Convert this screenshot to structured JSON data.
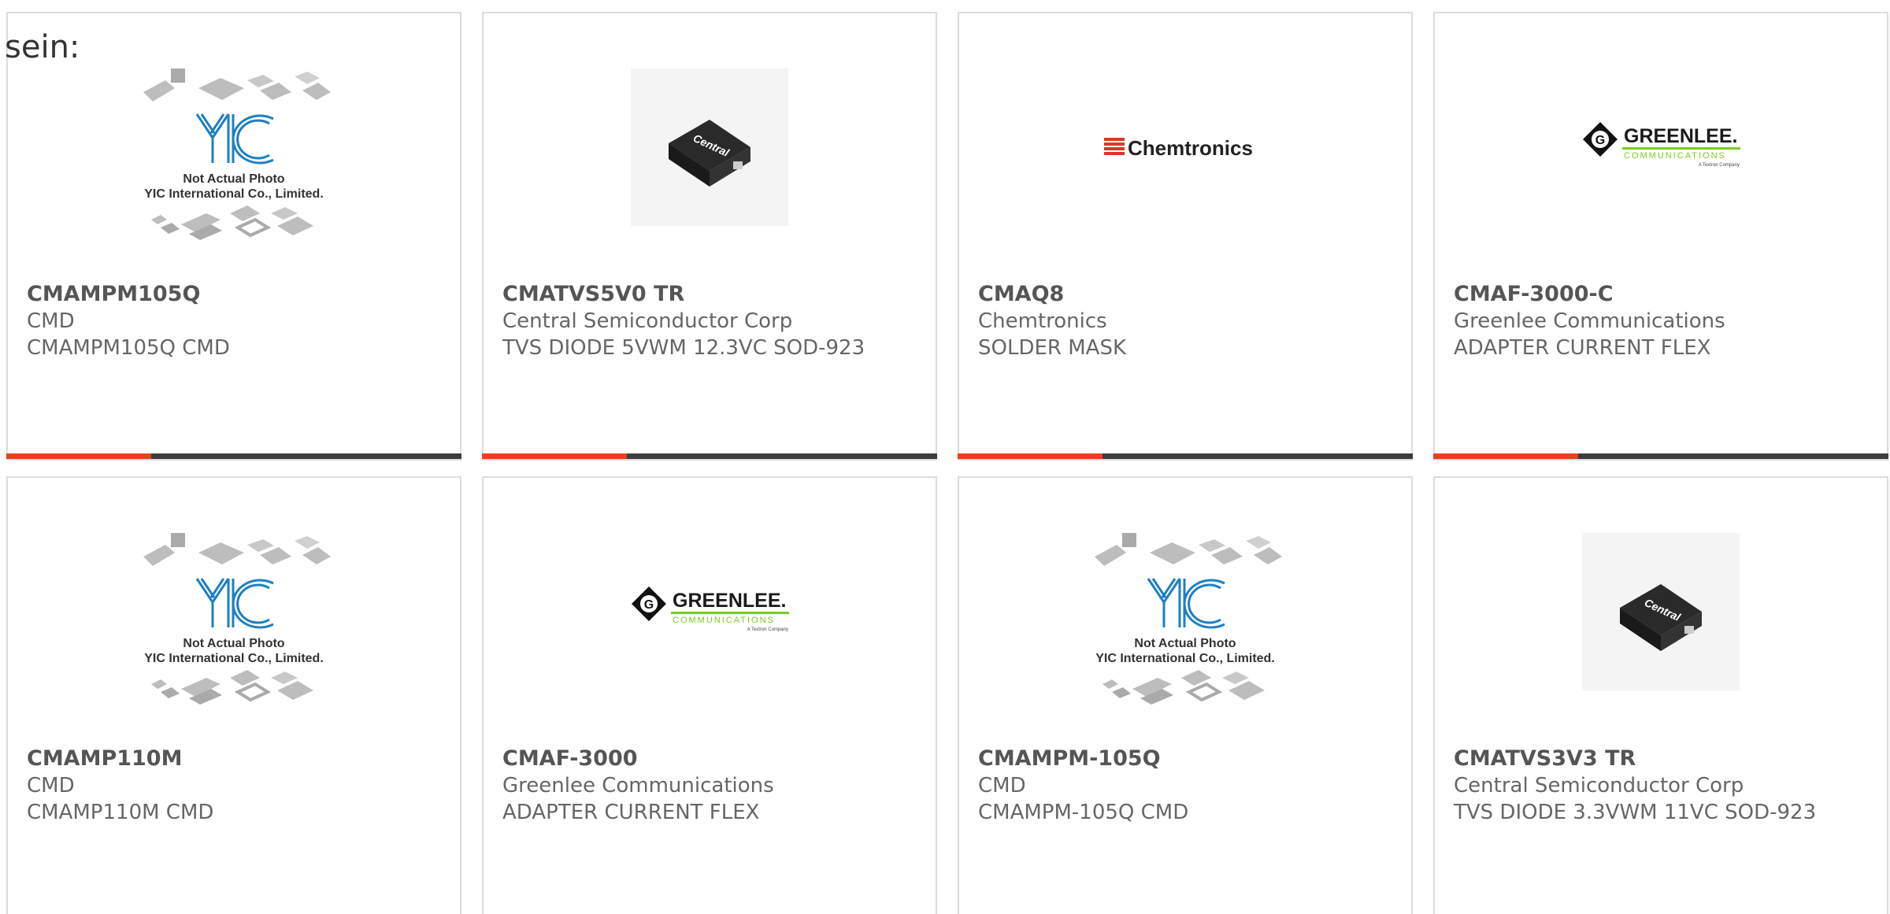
{
  "intro_text": "sein:",
  "products": [
    {
      "part_number": "CMAMPM105Q",
      "manufacturer": "CMD",
      "description": "CMAMPM105Q CMD",
      "image": {
        "kind": "placeholder",
        "icon": "yic-placeholder-image",
        "caption_line1": "Not Actual Photo",
        "caption_line2": "YIC International Co., Limited."
      }
    },
    {
      "part_number": "CMATVS5V0 TR",
      "manufacturer": "Central Semiconductor Corp",
      "description": "TVS DIODE 5VWM 12.3VC SOD-923",
      "image": {
        "kind": "photo",
        "icon": "sod923-chip-photo",
        "brand_text": "Central"
      }
    },
    {
      "part_number": "CMAQ8",
      "manufacturer": "Chemtronics",
      "description": "SOLDER MASK",
      "image": {
        "kind": "logo",
        "icon": "chemtronics-logo",
        "logo_text": "Chemtronics"
      }
    },
    {
      "part_number": "CMAF-3000-C",
      "manufacturer": "Greenlee Communications",
      "description": "ADAPTER CURRENT FLEX",
      "image": {
        "kind": "logo",
        "icon": "greenlee-logo",
        "logo_text": "GREENLEE.",
        "logo_sub": "COMMUNICATIONS",
        "logo_tiny": "A Textron Company"
      }
    },
    {
      "part_number": "CMAMP110M",
      "manufacturer": "CMD",
      "description": "CMAMP110M CMD",
      "image": {
        "kind": "placeholder",
        "icon": "yic-placeholder-image",
        "caption_line1": "Not Actual Photo",
        "caption_line2": "YIC International Co., Limited."
      }
    },
    {
      "part_number": "CMAF-3000",
      "manufacturer": "Greenlee Communications",
      "description": "ADAPTER CURRENT FLEX",
      "image": {
        "kind": "logo",
        "icon": "greenlee-logo",
        "logo_text": "GREENLEE.",
        "logo_sub": "COMMUNICATIONS",
        "logo_tiny": "A Textron Company"
      }
    },
    {
      "part_number": "CMAMPM-105Q",
      "manufacturer": "CMD",
      "description": "CMAMPM-105Q CMD",
      "image": {
        "kind": "placeholder",
        "icon": "yic-placeholder-image",
        "caption_line1": "Not Actual Photo",
        "caption_line2": "YIC International Co., Limited."
      }
    },
    {
      "part_number": "CMATVS3V3 TR",
      "manufacturer": "Central Semiconductor Corp",
      "description": "TVS DIODE 3.3VWM 11VC SOD-923",
      "image": {
        "kind": "photo",
        "icon": "sod923-chip-photo",
        "brand_text": "Central"
      }
    }
  ],
  "colors": {
    "accent_bar": "#e8401c",
    "dark_bar": "#3d3d3d",
    "card_border": "#dcdcdc",
    "text": "#666666",
    "greenlee_green": "#7ccc1f",
    "chemtronics_red": "#d8382a",
    "yic_blue": "#1e7fc3"
  }
}
